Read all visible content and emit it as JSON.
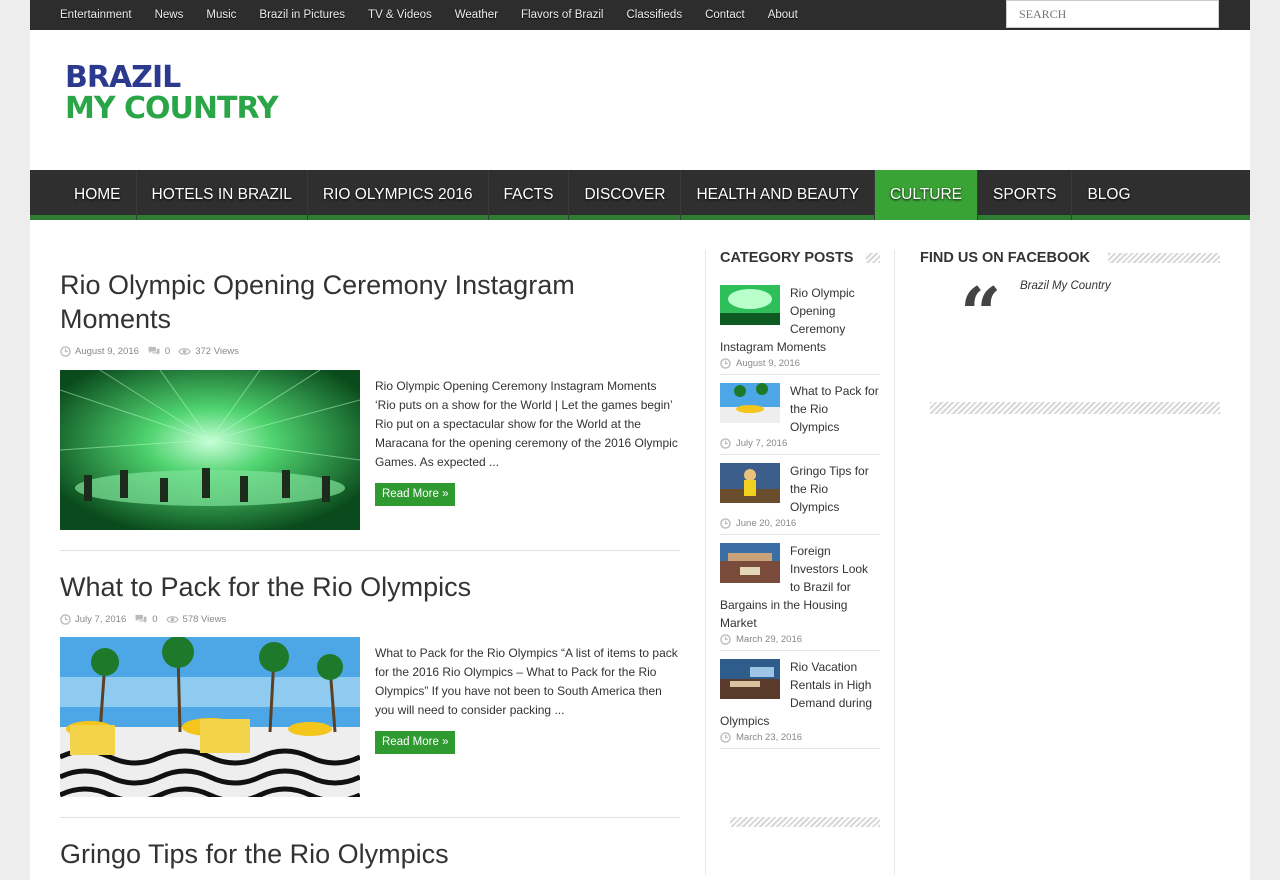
{
  "topbar": {
    "links": [
      "Entertainment",
      "News",
      "Music",
      "Brazil in Pictures",
      "TV & Videos",
      "Weather",
      "Flavors of Brazil",
      "Classifieds",
      "Contact",
      "About"
    ],
    "search_placeholder": "SEARCH"
  },
  "logo": {
    "line1": "BRAZIL",
    "line2": "MY COUNTRY"
  },
  "mainnav": {
    "items": [
      "HOME",
      "HOTELS IN BRAZIL",
      "RIO OLYMPICS 2016",
      "FACTS",
      "DISCOVER",
      "HEALTH AND BEAUTY",
      "CULTURE",
      "SPORTS",
      "BLOG"
    ],
    "active": "CULTURE"
  },
  "posts": [
    {
      "title": "Rio Olympic Opening Ceremony Instagram Moments",
      "date": "August 9, 2016",
      "comments": "0",
      "views": "372 Views",
      "excerpt": "Rio Olympic Opening Ceremony Instagram Moments ‘Rio puts on a show for the World | Let the games begin’ Rio put on a spectacular show for the World at the Maracana for the opening ceremony of the 2016 Olympic Games. As expected ...",
      "more": "Read More »"
    },
    {
      "title": "What to Pack for the Rio Olympics",
      "date": "July 7, 2016",
      "comments": "0",
      "views": "578 Views",
      "excerpt": "What to Pack for the Rio Olympics “A list of items to pack for the 2016 Rio Olympics – What to Pack for the Rio Olympics”  If you have not been to South America then you will need to consider packing ...",
      "more": "Read More »"
    },
    {
      "title": "Gringo Tips for the Rio Olympics"
    }
  ],
  "category_posts": {
    "title": "CATEGORY POSTS",
    "items": [
      {
        "title": "Rio Olympic Opening Ceremony Instagram Moments",
        "date": "August 9, 2016"
      },
      {
        "title": "What to Pack for the Rio Olympics",
        "date": "July 7, 2016"
      },
      {
        "title": "Gringo Tips for the Rio Olympics",
        "date": "June 20, 2016"
      },
      {
        "title": "Foreign Investors Look to Brazil for Bargains in the Housing Market",
        "date": "March 29, 2016"
      },
      {
        "title": "Rio Vacation Rentals in High Demand during Olympics",
        "date": "March 23, 2016"
      }
    ]
  },
  "facebook": {
    "title": "FIND US ON FACEBOOK",
    "page_name": "Brazil My Country"
  },
  "colors": {
    "accent_green": "#2e9a30",
    "nav_bg": "#2f2f2f",
    "logo_blue": "#2b3a8f",
    "logo_green": "#2aa648"
  }
}
